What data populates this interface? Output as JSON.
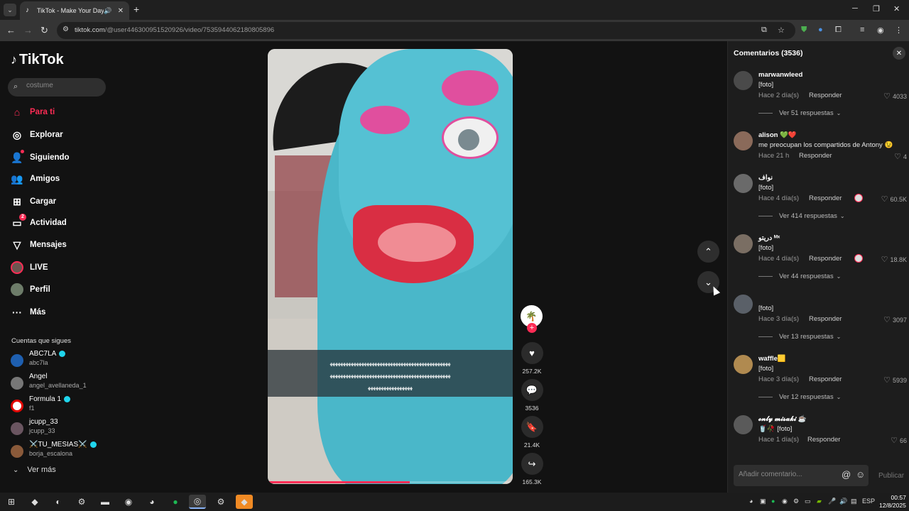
{
  "browser": {
    "tab_title": "TikTok - Make Your Day",
    "url_host": "tiktok.com",
    "url_path": "/@user446300951520926/video/7535944062180805896"
  },
  "sidebar": {
    "logo": "TikTok",
    "search_placeholder": "costume",
    "nav": [
      {
        "label": "Para ti",
        "icon": "home-icon",
        "active": true
      },
      {
        "label": "Explorar",
        "icon": "compass-icon"
      },
      {
        "label": "Siguiendo",
        "icon": "following-icon"
      },
      {
        "label": "Amigos",
        "icon": "friends-icon"
      },
      {
        "label": "Cargar",
        "icon": "upload-icon"
      },
      {
        "label": "Actividad",
        "icon": "activity-icon",
        "badge": "2"
      },
      {
        "label": "Mensajes",
        "icon": "messages-icon"
      },
      {
        "label": "LIVE",
        "icon": "live-avatar"
      },
      {
        "label": "Perfil",
        "icon": "profile-avatar"
      },
      {
        "label": "Más",
        "icon": "more-icon"
      }
    ],
    "following_header": "Cuentas que sigues",
    "following": [
      {
        "name": "ABC7LA",
        "handle": "abc7la",
        "verified": true
      },
      {
        "name": "Angel",
        "handle": "angel_avellaneda_1",
        "verified": false
      },
      {
        "name": "Formula 1",
        "handle": "f1",
        "verified": true
      },
      {
        "name": "jcupp_33",
        "handle": "jcupp_33",
        "verified": false
      },
      {
        "name": "⚔️TU_MESIAS⚔️",
        "handle": "borja_escalona",
        "verified": true
      }
    ],
    "see_more": "Ver más"
  },
  "video": {
    "caption_lines": [
      "ﻬﻬﻬﻬﻬﻬﻬﻬﻬﻬﻬﻬﻬﻬﻬﻬﻬﻬﻬﻬﻬﻬﻬﻬﻬﻬﻬﻬﻬﻬﻬﻬﻬﻬﻬﻬﻬﻬﻬﻬﻬﻬﻬﻬﻬﻬ",
      "ﻬﻬﻬﻬﻬﻬﻬﻬﻬﻬﻬﻬﻬﻬﻬﻬﻬﻬﻬﻬﻬﻬﻬﻬﻬﻬﻬﻬﻬﻬﻬﻬﻬﻬﻬﻬﻬﻬﻬﻬﻬﻬﻬﻬﻬﻬ",
      "ﻬﻬﻬﻬﻬﻬﻬﻬﻬﻬﻬﻬﻬﻬﻬﻬﻬ"
    ],
    "progress": 0.58,
    "likes": "257.2K",
    "comments": "3536",
    "saves": "21.4K",
    "shares": "165.3K"
  },
  "comments_panel": {
    "title": "Comentarios (3536)",
    "reply_label": "Responder",
    "items": [
      {
        "user": "marwanwleed",
        "text": "[foto]",
        "time": "Hace 2 día(s)",
        "likes": "4033",
        "replies": "Ver 51 respuestas",
        "avatar_color": "#4a4a4a"
      },
      {
        "user": "alison 💚❤️",
        "text": "me preocupan los compartidos de Antony 😉",
        "time": "Hace 21 h",
        "likes": "4",
        "replies": "",
        "avatar_color": "#8a6a5a"
      },
      {
        "user": "نواف",
        "text": "[foto]",
        "time": "Hace 4 día(s)",
        "likes": "60.5K",
        "replies": "Ver 414 respuestas",
        "creator_liked": true,
        "avatar_color": "#6a6a6a"
      },
      {
        "user": "دريتو ᴹˣ",
        "text": "[foto]",
        "time": "Hace 4 día(s)",
        "likes": "18.8K",
        "replies": "Ver 44 respuestas",
        "creator_liked": true,
        "avatar_color": "#7a6e63"
      },
      {
        "user": "",
        "text": "[foto]",
        "time": "Hace 3 día(s)",
        "likes": "3097",
        "replies": "Ver 13 respuestas",
        "avatar_color": "#5a6068"
      },
      {
        "user": "waffle🟨",
        "text": "[foto]",
        "time": "Hace 3 día(s)",
        "likes": "5939",
        "replies": "Ver 12 respuestas",
        "avatar_color": "#b08a50"
      },
      {
        "user": "𝓸𝓷𝓵𝔂 𝓶𝓲𝓼𝓪𝓴𝓲 ☕",
        "text": "🥤🥀 [foto]",
        "time": "Hace 1 día(s)",
        "likes": "66",
        "replies": "",
        "avatar_color": "#5a5a5a"
      }
    ],
    "input_placeholder": "Añadir comentario...",
    "publish": "Publicar"
  },
  "taskbar": {
    "lang": "ESP",
    "time": "00:57",
    "date": "12/8/2025"
  }
}
